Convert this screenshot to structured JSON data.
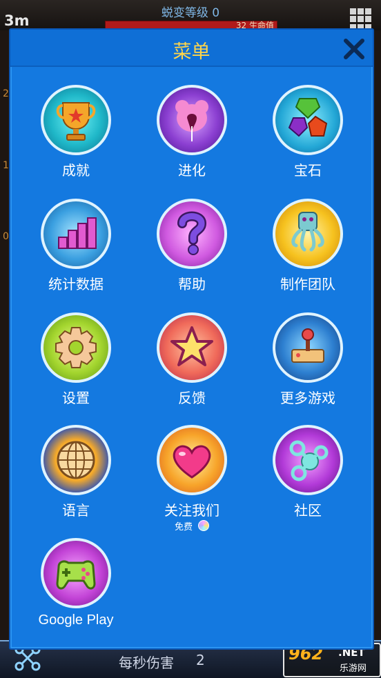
{
  "background": {
    "evolution_level": "蜕变等级 0",
    "distance": "3m",
    "bar_text": "32 生命值",
    "side_numbers": [
      "2",
      "1",
      "0"
    ],
    "damage_per_second_label": "每秒伤害",
    "damage_per_second_value": "2",
    "watermark": {
      "logo": "962",
      "net": ".NET",
      "sub": "乐游网"
    }
  },
  "menu": {
    "title": "菜单",
    "items": [
      {
        "label": "成就",
        "icon": "trophy-icon"
      },
      {
        "label": "进化",
        "icon": "evolution-icon"
      },
      {
        "label": "宝石",
        "icon": "gems-icon"
      },
      {
        "label": "统计数据",
        "icon": "stats-icon"
      },
      {
        "label": "帮助",
        "icon": "question-icon"
      },
      {
        "label": "制作团队",
        "icon": "octopus-icon"
      },
      {
        "label": "设置",
        "icon": "gear-icon"
      },
      {
        "label": "反馈",
        "icon": "star-icon"
      },
      {
        "label": "更多游戏",
        "icon": "joystick-icon"
      },
      {
        "label": "语言",
        "icon": "globe-icon"
      },
      {
        "label": "关注我们",
        "icon": "heart-icon",
        "sub": "免费"
      },
      {
        "label": "社区",
        "icon": "community-icon"
      },
      {
        "label": "Google Play",
        "icon": "gamepad-icon"
      }
    ]
  },
  "colors": {
    "panel": "#1479e0",
    "title": "#ffd54a",
    "health_bar": "#b01a1a"
  }
}
